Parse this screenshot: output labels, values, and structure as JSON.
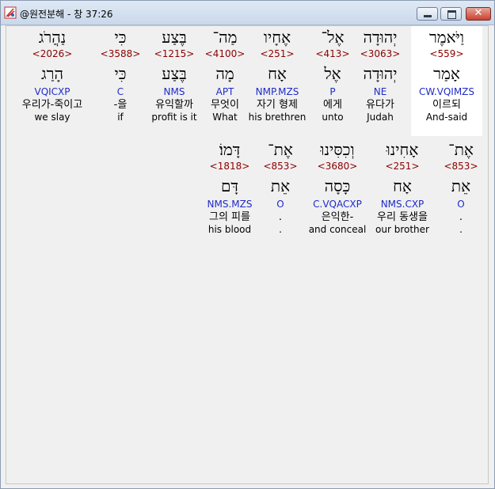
{
  "window": {
    "title": "@원전분해 - 창 37:26",
    "close_glyph": "✕"
  },
  "rows": [
    [
      {
        "heb": "וַיֹּאמֶר",
        "strong": "<559>",
        "root": "אָמַר",
        "parse": "CW.VQIMZS",
        "kor": "이르되",
        "eng": "And-said",
        "selected": true
      },
      {
        "heb": "יְהוּדָה",
        "strong": "<3063>",
        "root": "יְהוּדָה",
        "parse": "NE",
        "kor": "유다가",
        "eng": "Judah"
      },
      {
        "heb": "אֶל־",
        "strong": "<413>",
        "root": "אֶל",
        "parse": "P",
        "kor": "에게",
        "eng": "unto"
      },
      {
        "heb": "אֶחָיו",
        "strong": "<251>",
        "root": "אָח",
        "parse": "NMP.MZS",
        "kor": "자기 형제",
        "eng": "his brethren"
      },
      {
        "heb": "מַה־",
        "strong": "<4100>",
        "root": "מָה",
        "parse": "APT",
        "kor": "무엇이",
        "eng": "What"
      },
      {
        "heb": "בֶּצַע",
        "strong": "<1215>",
        "root": "בֶּצַע",
        "parse": "NMS",
        "kor": "유익할까",
        "eng": "profit is it"
      },
      {
        "heb": "כִּי",
        "strong": "<3588>",
        "root": "כִּי",
        "parse": "C",
        "kor": "-을",
        "eng": "if"
      },
      {
        "heb": "נַהֲרֹג",
        "strong": "<2026>",
        "root": "הָרַג",
        "parse": "VQICXP",
        "kor": "우리가-죽이고",
        "eng": "we slay"
      }
    ],
    [
      {
        "heb": "אֶת־",
        "strong": "<853>",
        "root": "אֵת",
        "parse": "O",
        "kor": ".",
        "eng": "."
      },
      {
        "heb": "אָחִינוּ",
        "strong": "<251>",
        "root": "אָח",
        "parse": "NMS.CXP",
        "kor": "우리 동생을",
        "eng": "our brother"
      },
      {
        "heb": "וְכִסִּינוּ",
        "strong": "<3680>",
        "root": "כָּסָה",
        "parse": "C.VQACXP",
        "kor": "은익한-",
        "eng": "and conceal"
      },
      {
        "heb": "אֶת־",
        "strong": "<853>",
        "root": "אֵת",
        "parse": "O",
        "kor": ".",
        "eng": "."
      },
      {
        "heb": "דָּמוֹ׃",
        "strong": "<1818>",
        "root": "דָּם",
        "parse": "NMS.MZS",
        "kor": "그의 피를",
        "eng": "his blood"
      }
    ]
  ]
}
